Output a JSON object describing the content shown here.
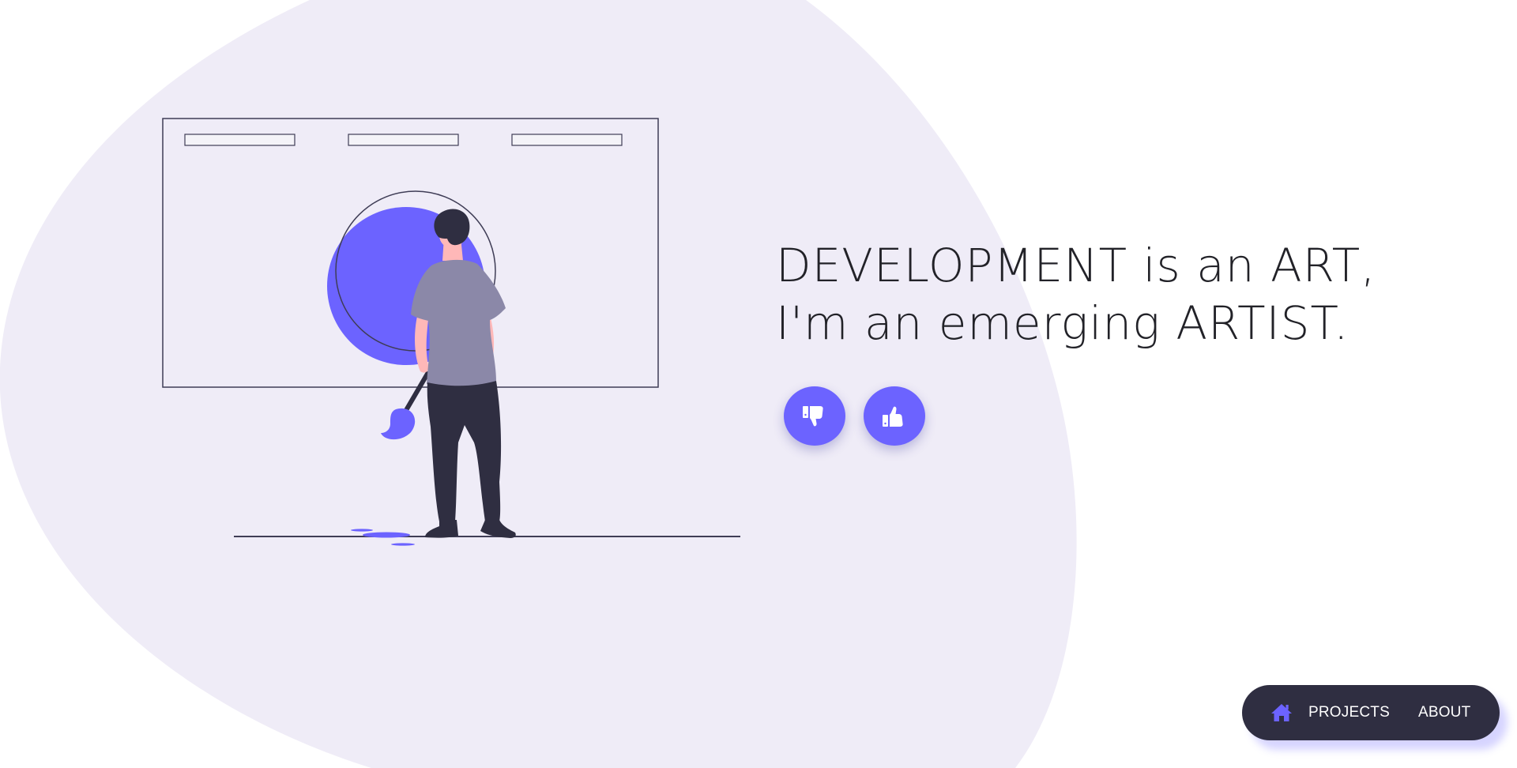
{
  "hero": {
    "headline_line1": "DEVELOPMENT is an ART,",
    "headline_line2": "I'm an emerging ARTIST."
  },
  "reactions": {
    "dislike": {
      "icon": "thumbs-down-icon",
      "aria": "Dislike"
    },
    "like": {
      "icon": "thumbs-up-icon",
      "aria": "Like"
    }
  },
  "nav": {
    "home_icon": "home-icon",
    "items": [
      {
        "label": "PROJECTS"
      },
      {
        "label": "ABOUT"
      }
    ]
  },
  "colors": {
    "accent": "#6c63ff",
    "blob": "#efecf7",
    "dark": "#2f2e41",
    "shirt": "#8b88a8",
    "skin": "#ffb8b8"
  }
}
